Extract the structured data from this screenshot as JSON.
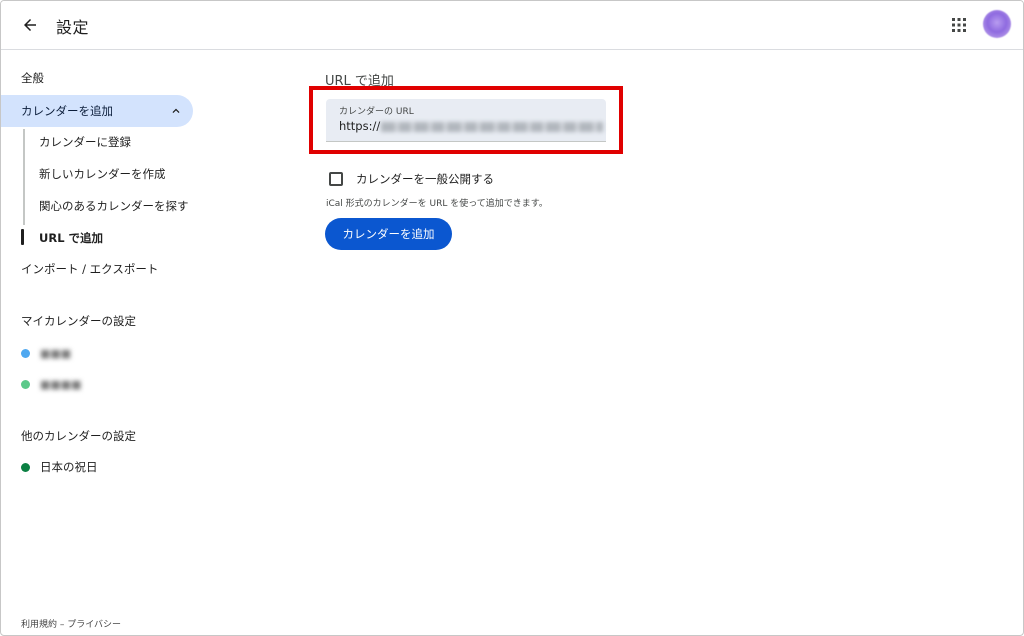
{
  "header": {
    "title": "設定",
    "back_icon": "arrow-back-icon",
    "apps_icon": "apps-grid-icon"
  },
  "sidebar": {
    "general": "全般",
    "add_calendar": "カレンダーを追加",
    "add_calendar_subitems": [
      {
        "label": "カレンダーに登録"
      },
      {
        "label": "新しいカレンダーを作成"
      },
      {
        "label": "関心のあるカレンダーを探す"
      },
      {
        "label": "URL で追加"
      }
    ],
    "import_export": "インポート / エクスポート",
    "my_calendars_heading": "マイカレンダーの設定",
    "my_calendars": [
      {
        "label": "■■■",
        "color": "#4fa8f0"
      },
      {
        "label": "■■■■",
        "color": "#5cc98a"
      }
    ],
    "other_calendars_heading": "他のカレンダーの設定",
    "other_calendars": [
      {
        "label": "日本の祝日",
        "color": "#0b8043"
      }
    ],
    "footer": "利用規約 – プライバシー"
  },
  "main": {
    "section_title": "URL で追加",
    "url_field": {
      "label": "カレンダーの URL",
      "value_prefix": "https://"
    },
    "public_checkbox_label": "カレンダーを一般公開する",
    "helper_text": "iCal 形式のカレンダーを URL を使って追加できます。",
    "add_button": "カレンダーを追加"
  },
  "colors": {
    "accent": "#0b57d0",
    "active_nav_bg": "#d3e3fd",
    "highlight": "#e00000"
  }
}
